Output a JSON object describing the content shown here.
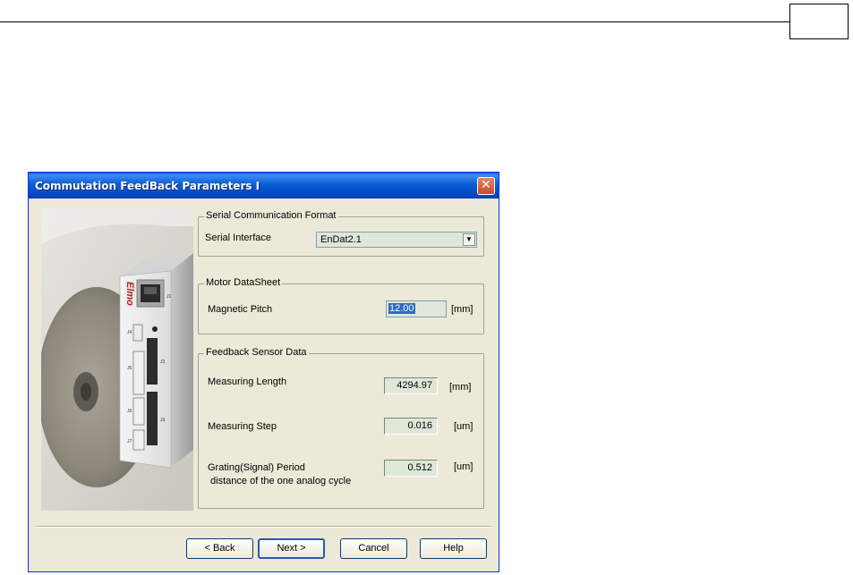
{
  "window": {
    "title": "Commutation FeedBack Parameters I",
    "close_glyph": "✕"
  },
  "serial_group": {
    "title": "Serial Communication Format",
    "interface_label": "Serial Interface",
    "interface_value": "EnDat2.1"
  },
  "motor_group": {
    "title": "Motor DataSheet",
    "pitch_label": "Magnetic Pitch",
    "pitch_value": "12.00",
    "pitch_unit": "[mm]"
  },
  "sensor_group": {
    "title": "Feedback Sensor Data",
    "length_label": "Measuring Length",
    "length_value": "4294.97",
    "length_unit": "[mm]",
    "step_label": "Measuring Step",
    "step_value": "0.016",
    "step_unit": "[um]",
    "period_label": "Grating(Signal) Period",
    "period_sublabel": " distance of the one analog cycle",
    "period_value": "0.512",
    "period_unit": "[um]"
  },
  "buttons": {
    "back": "< Back",
    "next": "Next >",
    "cancel": "Cancel",
    "help": "Help"
  },
  "device": {
    "brand": "Elmo",
    "connector_labels": [
      "J1",
      "J4",
      "J2",
      "J5",
      "J6",
      "J3",
      "J7"
    ]
  },
  "colors": {
    "titlebar": "#0a5ed4",
    "dialog_bg": "#ece9d8",
    "field_bg": "#dfe8d8",
    "brand_red": "#d01010"
  }
}
